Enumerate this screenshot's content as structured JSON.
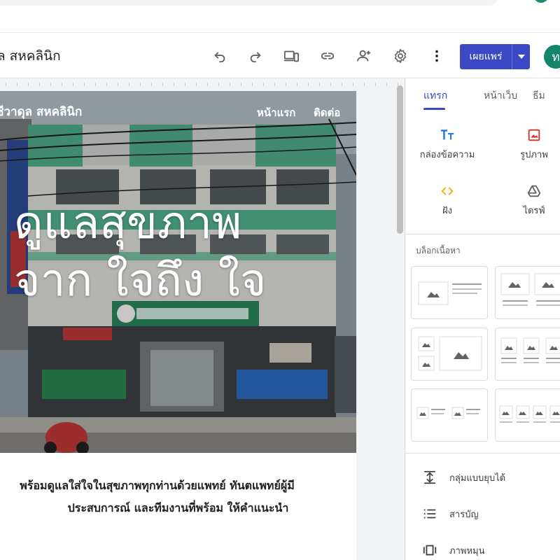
{
  "header": {
    "site_title": "ล สหคลินิก",
    "publish_label": "เผยแพร่",
    "avatar_initial": "ท"
  },
  "page": {
    "brand": "ชีวาดุล สหคลินิก",
    "nav": {
      "home": "หน้าแรก",
      "contact": "ติดต่อ"
    },
    "hero_heading": [
      "ดูแลสุขภาพ",
      "จาก ใจถึง ใจ"
    ],
    "intro_lines": [
      "พร้อมดูแลใส่ใจในสุขภาพทุกท่านด้วยแพทย์ ทันตแพทย์ผู้มี",
      "ประสบการณ์ และทีมงานที่พร้อม ให้คำแนะนำ"
    ]
  },
  "panel": {
    "tabs": {
      "insert": "แทรก",
      "pages": "หน้าเว็บ",
      "themes": "ธีม"
    },
    "insert_items": {
      "text_box": "กล่องข้อความ",
      "images": "รูปภาพ",
      "embed": "ฝัง",
      "drive": "ไดรฟ์"
    },
    "content_blocks_label": "บล็อกเนื้อหา",
    "rows": {
      "collapsible": "กลุ่มแบบยุบได้",
      "toc": "สารบัญ",
      "carousel": "ภาพหมุน"
    }
  },
  "colors": {
    "accent": "#3b49c6",
    "avatar": "#13856a",
    "clinic_green": "#3fae8c"
  },
  "icons": {
    "undo": "undo-icon",
    "redo": "redo-icon",
    "preview": "device-preview-icon",
    "link": "link-icon",
    "share": "add-person-icon",
    "settings": "gear-icon",
    "more": "more-vert-icon"
  }
}
